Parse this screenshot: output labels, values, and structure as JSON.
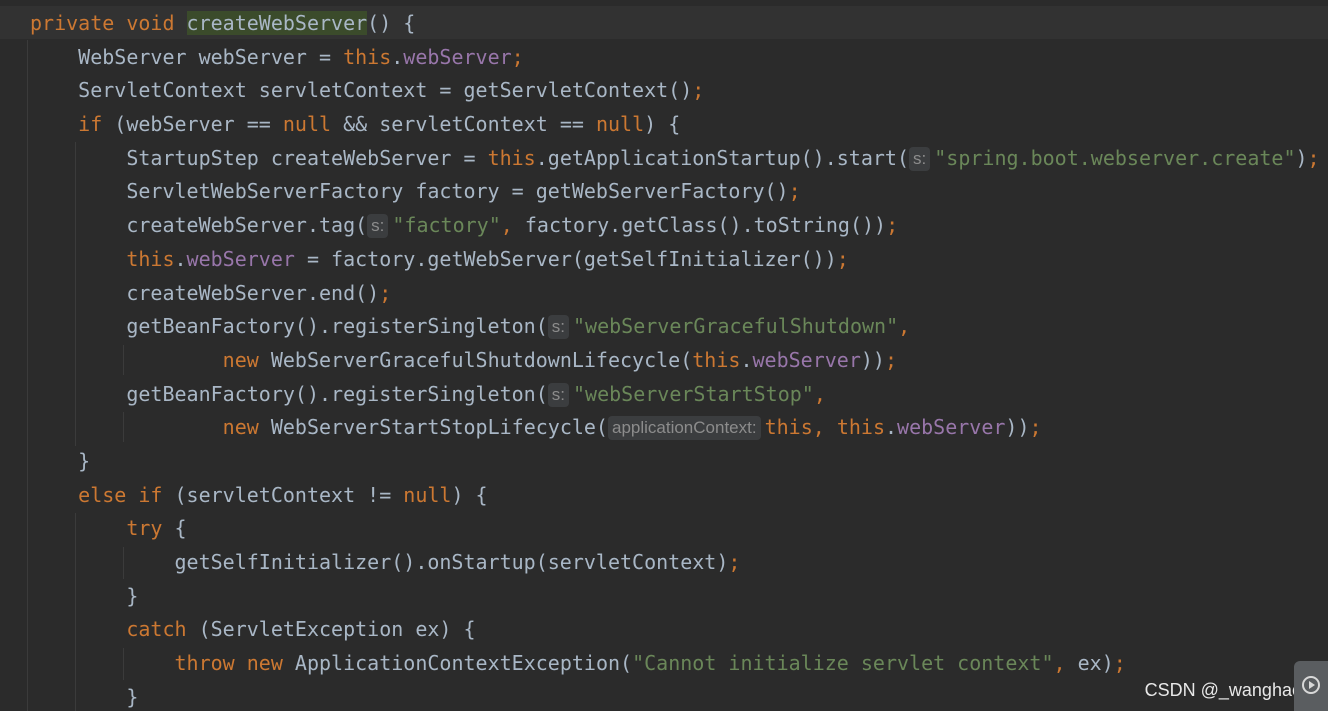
{
  "editor": {
    "lines": [
      {
        "tokens": [
          [
            "k",
            "private void "
          ],
          [
            "sel",
            "createWebServer"
          ],
          [
            "p",
            "() {"
          ]
        ]
      },
      {
        "tokens": [
          [
            "p",
            "    WebServer webServer = "
          ],
          [
            "k",
            "this"
          ],
          [
            "p",
            "."
          ],
          [
            "f",
            "webServer"
          ],
          [
            "k",
            ";"
          ]
        ]
      },
      {
        "tokens": [
          [
            "p",
            "    ServletContext servletContext = getServletContext()"
          ],
          [
            "k",
            ";"
          ]
        ]
      },
      {
        "tokens": [
          [
            "p",
            "    "
          ],
          [
            "k",
            "if "
          ],
          [
            "p",
            "(webServer == "
          ],
          [
            "k",
            "null "
          ],
          [
            "p",
            "&& servletContext == "
          ],
          [
            "k",
            "null"
          ],
          [
            "p",
            ") {"
          ]
        ]
      },
      {
        "tokens": [
          [
            "p",
            "        StartupStep createWebServer = "
          ],
          [
            "k",
            "this"
          ],
          [
            "p",
            ".getApplicationStartup().start("
          ],
          [
            "hint",
            "s:"
          ],
          [
            "s",
            "\"spring.boot.webserver.create\""
          ],
          [
            "p",
            ")"
          ],
          [
            "k",
            ";"
          ]
        ]
      },
      {
        "tokens": [
          [
            "p",
            "        ServletWebServerFactory factory = getWebServerFactory()"
          ],
          [
            "k",
            ";"
          ]
        ]
      },
      {
        "tokens": [
          [
            "p",
            "        createWebServer.tag("
          ],
          [
            "hint",
            "s:"
          ],
          [
            "s",
            "\"factory\""
          ],
          [
            "k",
            ", "
          ],
          [
            "p",
            "factory.getClass().toString())"
          ],
          [
            "k",
            ";"
          ]
        ]
      },
      {
        "tokens": [
          [
            "p",
            "        "
          ],
          [
            "k",
            "this"
          ],
          [
            "p",
            "."
          ],
          [
            "f",
            "webServer"
          ],
          [
            "p",
            " = factory.getWebServer(getSelfInitializer())"
          ],
          [
            "k",
            ";"
          ]
        ]
      },
      {
        "tokens": [
          [
            "p",
            "        createWebServer.end()"
          ],
          [
            "k",
            ";"
          ]
        ]
      },
      {
        "tokens": [
          [
            "p",
            "        getBeanFactory().registerSingleton("
          ],
          [
            "hint",
            "s:"
          ],
          [
            "s",
            "\"webServerGracefulShutdown\""
          ],
          [
            "k",
            ","
          ]
        ]
      },
      {
        "tokens": [
          [
            "p",
            "                "
          ],
          [
            "k",
            "new "
          ],
          [
            "p",
            "WebServerGracefulShutdownLifecycle("
          ],
          [
            "k",
            "this"
          ],
          [
            "p",
            "."
          ],
          [
            "f",
            "webServer"
          ],
          [
            "p",
            "))"
          ],
          [
            "k",
            ";"
          ]
        ]
      },
      {
        "tokens": [
          [
            "p",
            "        getBeanFactory().registerSingleton("
          ],
          [
            "hint",
            "s:"
          ],
          [
            "s",
            "\"webServerStartStop\""
          ],
          [
            "k",
            ","
          ]
        ]
      },
      {
        "tokens": [
          [
            "p",
            "                "
          ],
          [
            "k",
            "new "
          ],
          [
            "p",
            "WebServerStartStopLifecycle("
          ],
          [
            "hint",
            "applicationContext:"
          ],
          [
            "k",
            "this, this"
          ],
          [
            "p",
            "."
          ],
          [
            "f",
            "webServer"
          ],
          [
            "p",
            "))"
          ],
          [
            "k",
            ";"
          ]
        ]
      },
      {
        "tokens": [
          [
            "p",
            "    }"
          ]
        ]
      },
      {
        "tokens": [
          [
            "p",
            "    "
          ],
          [
            "k",
            "else if "
          ],
          [
            "p",
            "(servletContext != "
          ],
          [
            "k",
            "null"
          ],
          [
            "p",
            ") {"
          ]
        ]
      },
      {
        "tokens": [
          [
            "p",
            "        "
          ],
          [
            "k",
            "try "
          ],
          [
            "p",
            "{"
          ]
        ]
      },
      {
        "tokens": [
          [
            "p",
            "            getSelfInitializer().onStartup(servletContext)"
          ],
          [
            "k",
            ";"
          ]
        ]
      },
      {
        "tokens": [
          [
            "p",
            "        }"
          ]
        ]
      },
      {
        "tokens": [
          [
            "p",
            "        "
          ],
          [
            "k",
            "catch "
          ],
          [
            "p",
            "(ServletException ex) {"
          ]
        ]
      },
      {
        "tokens": [
          [
            "p",
            "            "
          ],
          [
            "k",
            "throw new "
          ],
          [
            "p",
            "ApplicationContextException("
          ],
          [
            "s",
            "\"Cannot initialize servlet context\""
          ],
          [
            "k",
            ", "
          ],
          [
            "p",
            "ex)"
          ],
          [
            "k",
            ";"
          ]
        ]
      },
      {
        "tokens": [
          [
            "p",
            "        }"
          ]
        ]
      }
    ]
  },
  "watermark": "CSDN @_wanghao_",
  "corner_button_icon": "play-icon"
}
